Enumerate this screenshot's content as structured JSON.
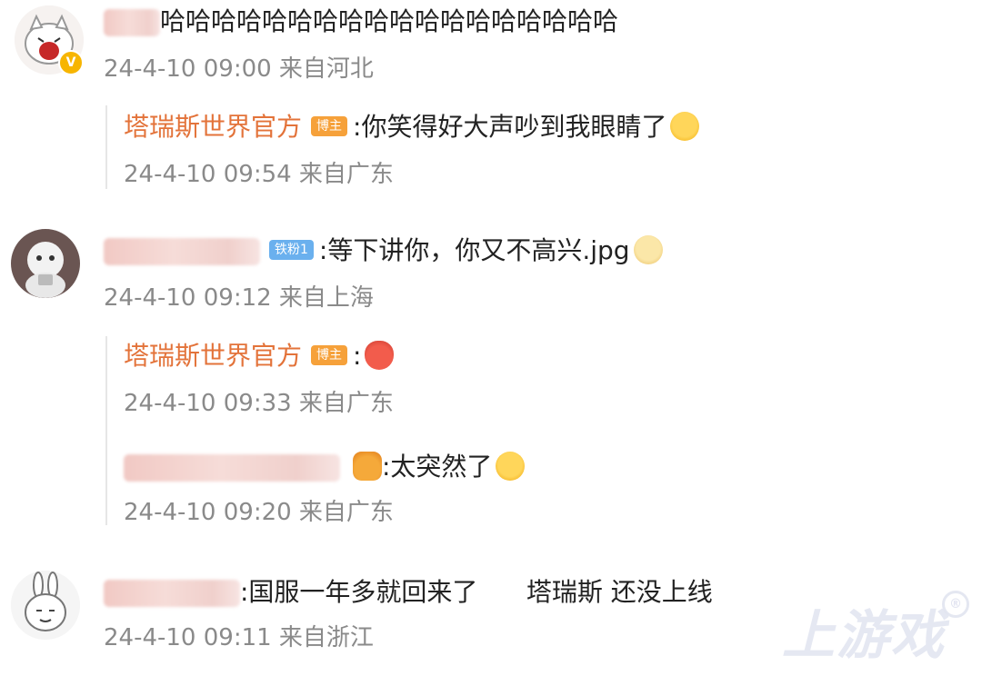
{
  "comments": [
    {
      "username": "",
      "text": "哈哈哈哈哈哈哈哈哈哈哈哈哈哈哈哈哈哈",
      "meta": "24-4-10 09:00 来自河北",
      "replies": [
        {
          "author": "塔瑞斯世界官方",
          "badge": "博主",
          "text": ":你笑得好大声吵到我眼睛了",
          "emoji": "crying-emoji",
          "meta": "24-4-10 09:54 来自广东"
        }
      ]
    },
    {
      "username": "",
      "badge": "铁粉1",
      "text": ":等下讲你，你又不高兴.jpg",
      "emoji": "doge-emoji",
      "meta": "24-4-10 09:12 来自上海",
      "replies": [
        {
          "author": "塔瑞斯世界官方",
          "badge": "博主",
          "text": ":",
          "emoji": "shocked-emoji",
          "meta": "24-4-10 09:33 来自广东"
        },
        {
          "author": "",
          "badge_icon": "crown-icon",
          "text": ":太突然了",
          "emoji": "sweat-emoji",
          "meta": "24-4-10 09:20 来自广东"
        }
      ]
    },
    {
      "username": "",
      "text": ":国服一年多就回来了      塔瑞斯 还没上线",
      "meta": "24-4-10 09:11 来自浙江"
    }
  ],
  "watermark": "上游戏"
}
